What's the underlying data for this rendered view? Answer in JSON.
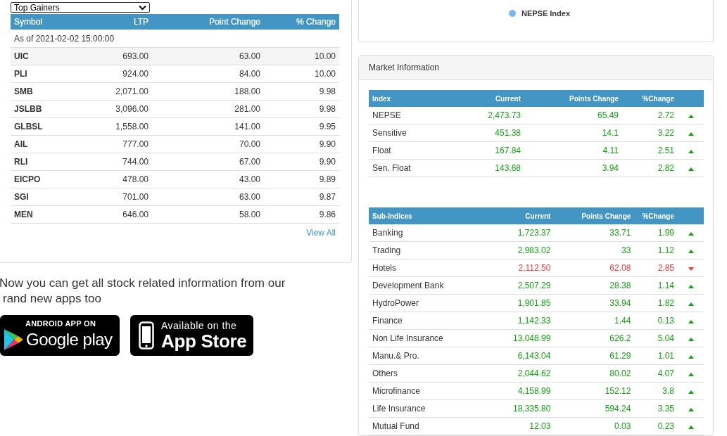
{
  "gainers": {
    "select": "Top Gainers",
    "columns": [
      "Symbol",
      "LTP",
      "Point Change",
      "% Change"
    ],
    "as_of": "As of 2021-02-02 15:00:00",
    "rows": [
      {
        "symbol": "UIC",
        "ltp": "693.00",
        "change": "63.00",
        "pct": "10.00"
      },
      {
        "symbol": "PLI",
        "ltp": "924.00",
        "change": "84.00",
        "pct": "10.00"
      },
      {
        "symbol": "SMB",
        "ltp": "2,071.00",
        "change": "188.00",
        "pct": "9.98"
      },
      {
        "symbol": "JSLBB",
        "ltp": "3,096.00",
        "change": "281.00",
        "pct": "9.98"
      },
      {
        "symbol": "GLBSL",
        "ltp": "1,558.00",
        "change": "141.00",
        "pct": "9.95"
      },
      {
        "symbol": "AIL",
        "ltp": "777.00",
        "change": "70.00",
        "pct": "9.90"
      },
      {
        "symbol": "RLI",
        "ltp": "744.00",
        "change": "67.00",
        "pct": "9.90"
      },
      {
        "symbol": "EICPO",
        "ltp": "478.00",
        "change": "43.00",
        "pct": "9.89"
      },
      {
        "symbol": "SGI",
        "ltp": "701.00",
        "change": "63.00",
        "pct": "9.87"
      },
      {
        "symbol": "MEN",
        "ltp": "646.00",
        "change": "58.00",
        "pct": "9.86"
      }
    ],
    "view_all": "View All"
  },
  "promo": {
    "lines": [
      "Now you can get all stock related information from our",
      "rand new apps too"
    ],
    "google_play": {
      "small": "ANDROID APP ON",
      "big": "Google play"
    },
    "app_store": {
      "small": "Available on the",
      "big": "App Store"
    }
  },
  "chart_legend": {
    "label": "NEPSE Index",
    "color": "#7cb5ec"
  },
  "market": {
    "title": "Market Information",
    "indices": {
      "columns": [
        "Index",
        "Current",
        "Points Change",
        "%Change"
      ],
      "rows": [
        {
          "name": "NEPSE",
          "current": "2,473.73",
          "change": "65.49",
          "pct": "2.72",
          "rising": true
        },
        {
          "name": "Sensitive",
          "current": "451.38",
          "change": "14.1",
          "pct": "3.22",
          "rising": true
        },
        {
          "name": "Float",
          "current": "167.84",
          "change": "4.11",
          "pct": "2.51",
          "rising": true
        },
        {
          "name": "Sen. Float",
          "current": "143.68",
          "change": "3.94",
          "pct": "2.82",
          "rising": true
        }
      ]
    },
    "sub_indices": {
      "columns": [
        "Sub-Indices",
        "Current",
        "Points Change",
        "%Change"
      ],
      "rows": [
        {
          "name": "Banking",
          "current": "1,723.37",
          "change": "33.71",
          "pct": "1.99",
          "rising": true
        },
        {
          "name": "Trading",
          "current": "2,983.02",
          "change": "33",
          "pct": "1.12",
          "rising": true
        },
        {
          "name": "Hotels",
          "current": "2,112.50",
          "change": "62.08",
          "pct": "2.85",
          "rising": false
        },
        {
          "name": "Development Bank",
          "current": "2,507.29",
          "change": "28.38",
          "pct": "1.14",
          "rising": true
        },
        {
          "name": "HydroPower",
          "current": "1,901.85",
          "change": "33.94",
          "pct": "1.82",
          "rising": true
        },
        {
          "name": "Finance",
          "current": "1,142.33",
          "change": "1.44",
          "pct": "0.13",
          "rising": true
        },
        {
          "name": "Non Life Insurance",
          "current": "13,048.99",
          "change": "626.2",
          "pct": "5.04",
          "rising": true
        },
        {
          "name": "Manu.& Pro.",
          "current": "6,143.04",
          "change": "61.29",
          "pct": "1.01",
          "rising": true
        },
        {
          "name": "Others",
          "current": "2,044.62",
          "change": "80.02",
          "pct": "4.07",
          "rising": true
        },
        {
          "name": "Microfinance",
          "current": "4,158.99",
          "change": "152.12",
          "pct": "3.8",
          "rising": true
        },
        {
          "name": "Life Insurance",
          "current": "18,335.80",
          "change": "594.24",
          "pct": "3.35",
          "rising": true
        },
        {
          "name": "Mutual Fund",
          "current": "12.03",
          "change": "0.03",
          "pct": "0.23",
          "rising": true
        }
      ]
    }
  }
}
